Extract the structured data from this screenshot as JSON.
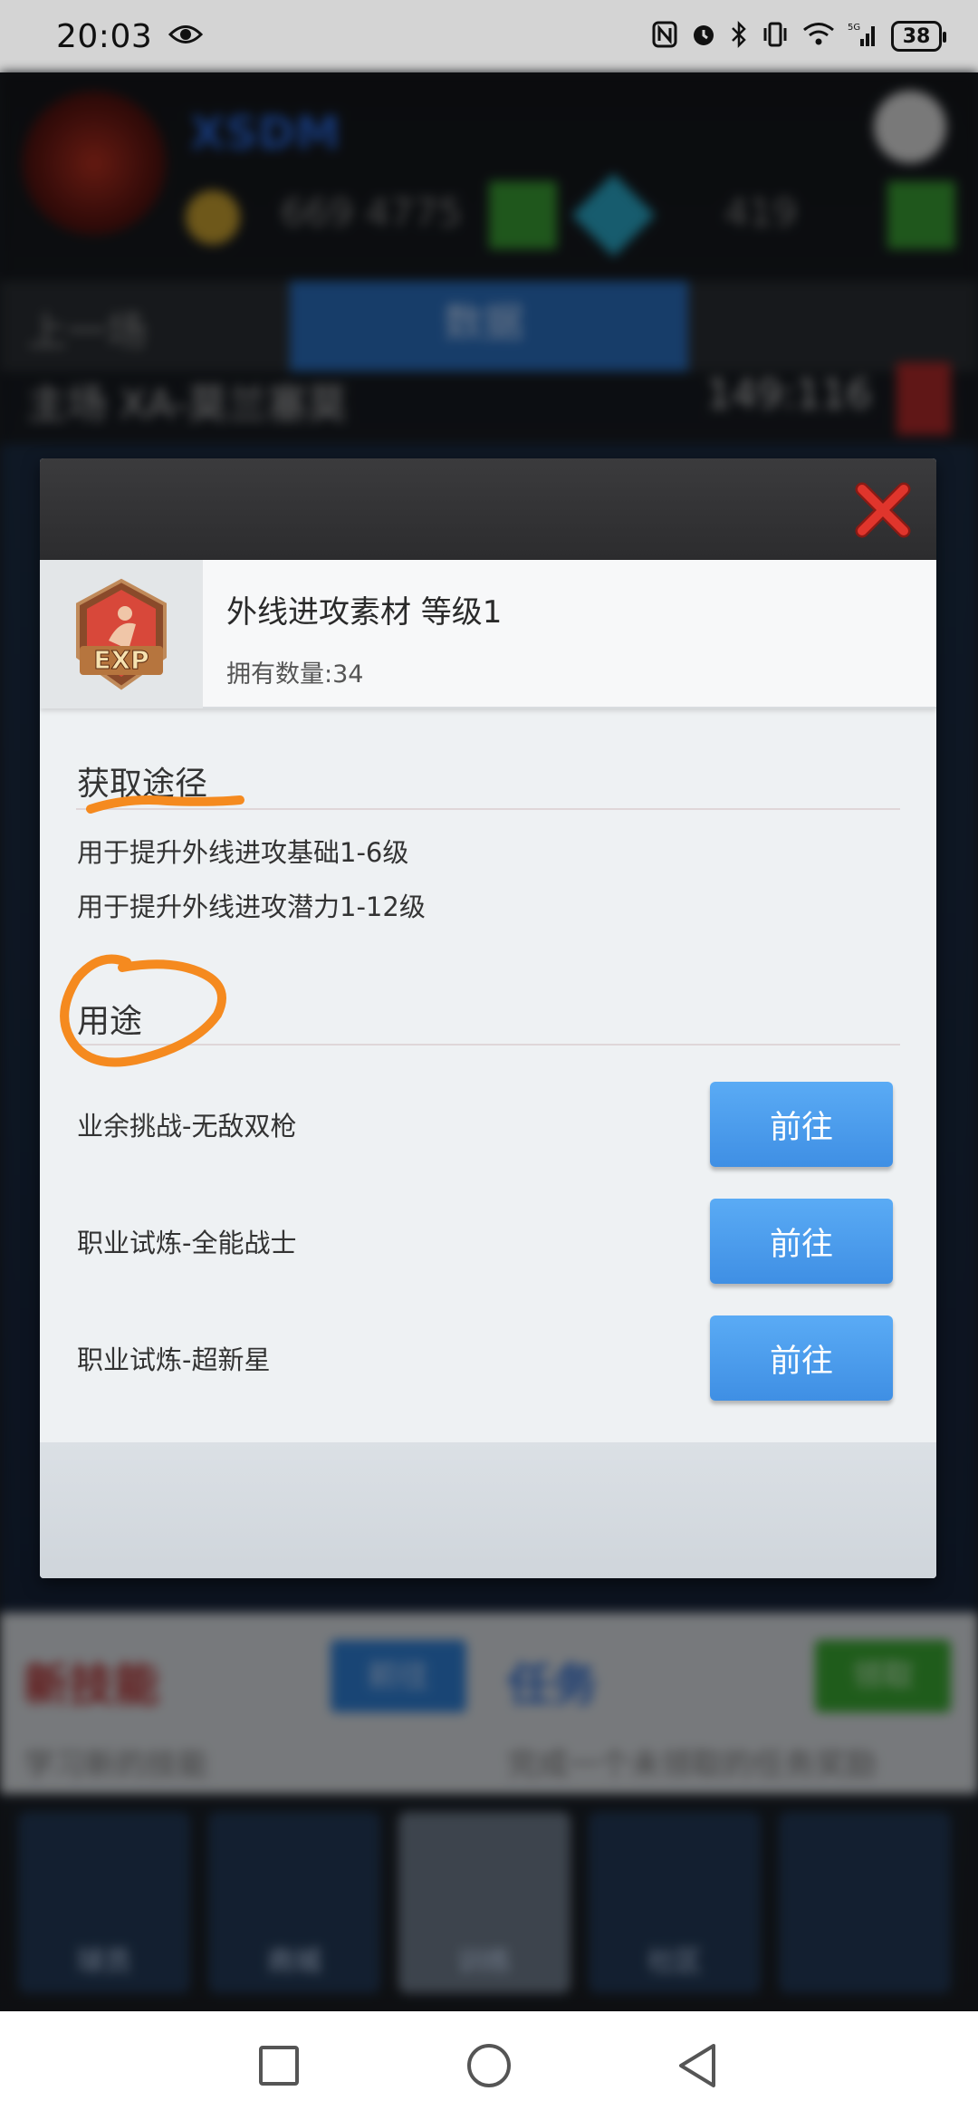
{
  "status_bar": {
    "time": "20:03",
    "battery": "38"
  },
  "background": {
    "game_title": "XSDM",
    "coins": "669 4775",
    "gems": "419",
    "tab_prev": "上一场",
    "tab_data": "数据",
    "match_row": "主场 XA-莫兰塞莫",
    "match_score": "149:116",
    "new_skill": "新技能",
    "new_skill_btn": "前往",
    "task": "任务",
    "task_btn": "领取",
    "new_skill_desc": "学习新的技能",
    "task_desc": "完成一个未领取的任务奖励",
    "nav_items": [
      "球员",
      "商城",
      "训练",
      "社区",
      ""
    ]
  },
  "dialog": {
    "item_name": "外线进攻素材 等级1",
    "item_quantity": "拥有数量:34",
    "item_icon_label": "EXP",
    "source_title": "获取途径",
    "source_lines": [
      "用于提升外线进攻基础1-6级",
      "用于提升外线进攻潜力1-12级"
    ],
    "usage_title": "用途",
    "usages": [
      {
        "label": "业余挑战-无敌双枪",
        "button": "前往"
      },
      {
        "label": "职业试炼-全能战士",
        "button": "前往"
      },
      {
        "label": "职业试炼-超新星",
        "button": "前往"
      }
    ]
  },
  "colors": {
    "accent_button": "#4a9cec",
    "close_red": "#d8322a",
    "annotation_orange": "#f58a1f"
  }
}
